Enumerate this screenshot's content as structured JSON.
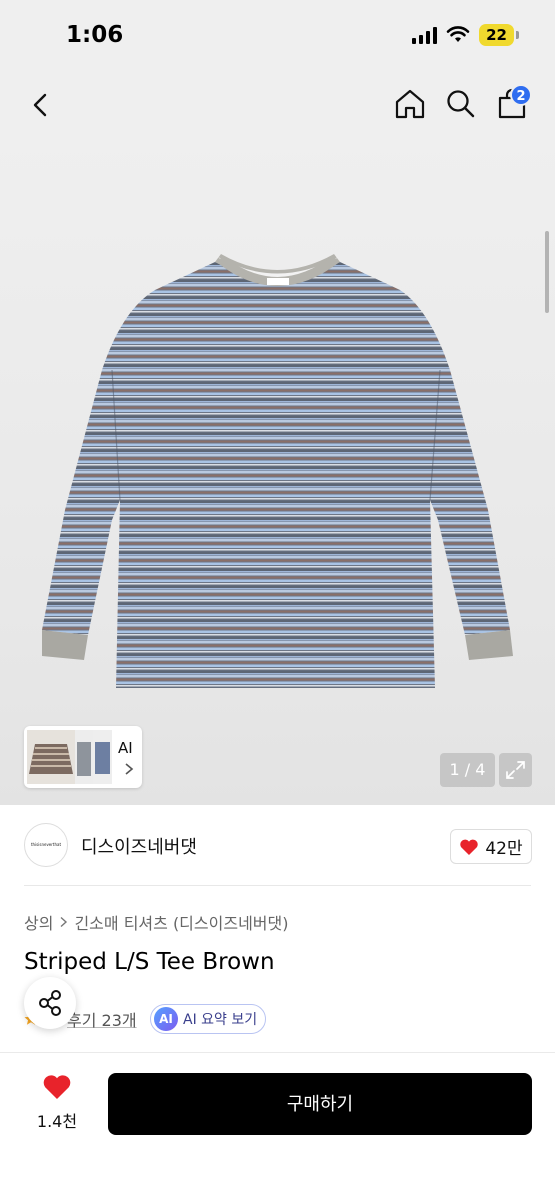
{
  "status_bar": {
    "time": "1:06",
    "battery": "22"
  },
  "nav": {
    "cart_count": "2"
  },
  "gallery": {
    "thumb_ai_label": "AI",
    "page_counter": "1 / 4"
  },
  "brand": {
    "logo_text": "thisisneverthat",
    "name": "디스이즈네버댓",
    "like_count": "42만"
  },
  "product": {
    "breadcrumb": [
      "상의",
      "긴소매 티셔츠 (디스이즈네버댓)"
    ],
    "title": "Striped L/S Tee Brown",
    "review_label": "후기 23개",
    "ai_badge": "AI",
    "ai_summary_label": "AI 요약 보기"
  },
  "bottom_bar": {
    "wish_count": "1.4천",
    "buy_label": "구매하기"
  },
  "colors": {
    "accent_blue": "#2f6df0",
    "heart_red": "#e8232b",
    "buy_button": "#000000"
  },
  "icons": [
    "back-arrow-icon",
    "home-icon",
    "search-icon",
    "shopping-bag-icon",
    "expand-icon",
    "chevron-right-icon",
    "heart-icon",
    "share-icon",
    "star-icon"
  ]
}
